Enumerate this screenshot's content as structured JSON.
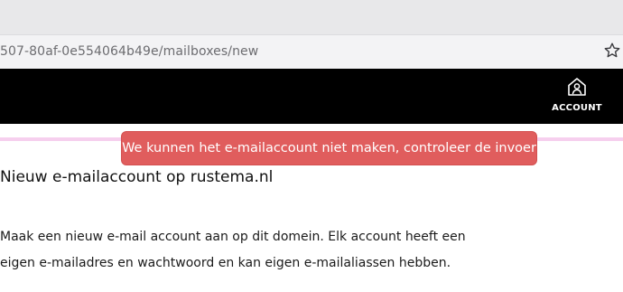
{
  "browser": {
    "url": "507-80af-0e554064b49e/mailboxes/new",
    "bookmark_icon": "star-icon"
  },
  "header": {
    "account_label": "ACCOUNT",
    "account_icon": "home-user-icon",
    "background": "#000000"
  },
  "notification": {
    "message": "We kunnen het e-mailaccount niet maken, controleer de invoer",
    "color": "#e05d5d"
  },
  "main": {
    "title": "Nieuw e-mailaccount op rustema.nl",
    "intro_line1": "Maak een nieuw e-mail account aan op dit domein. Elk account heeft een",
    "intro_line2": "eigen e-mailadres en wachtwoord en kan eigen e-mailaliassen hebben."
  },
  "colors": {
    "divider": "#f6cfee"
  }
}
